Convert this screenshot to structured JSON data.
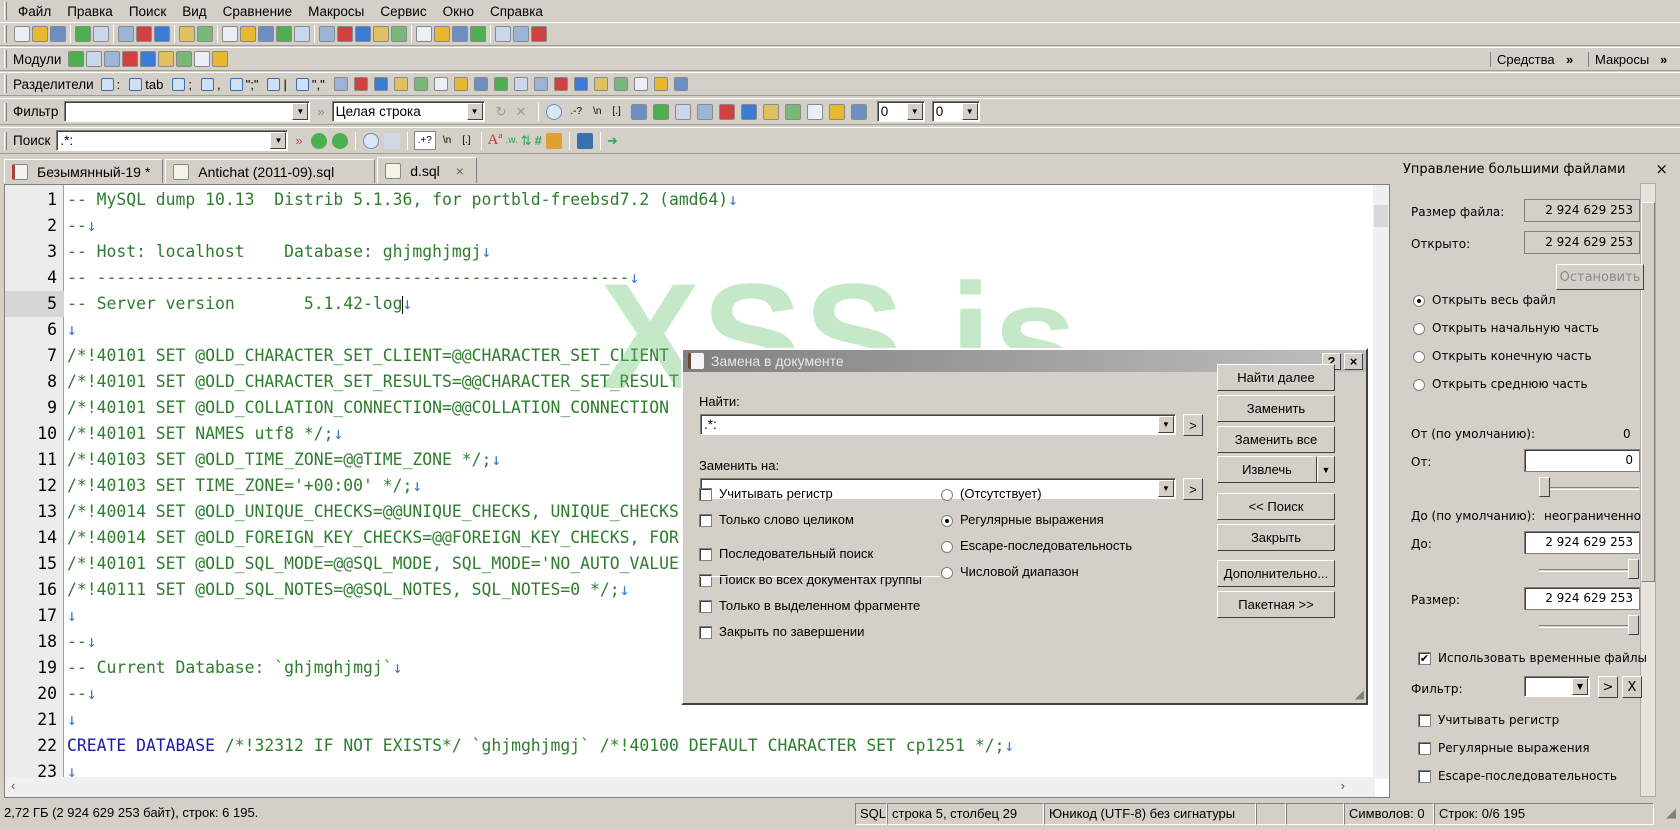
{
  "menu": [
    "Файл",
    "Правка",
    "Поиск",
    "Вид",
    "Сравнение",
    "Макросы",
    "Сервис",
    "Окно",
    "Справка"
  ],
  "toolbar_main": [
    "new-file-icon",
    "open-folder-icon",
    "save-icon",
    "print-icon",
    "print-preview-icon",
    "cut-icon",
    "copy-icon",
    "paste-icon",
    "undo-icon",
    "redo-icon",
    "find-icon",
    "find-next-icon",
    "find-prev-icon",
    "find-in-files-icon",
    "filter-icon",
    "columns-icon",
    "wrap-icon",
    "refresh-icon",
    "compare-icon",
    "tree-icon",
    "globe-icon",
    "macro-icon",
    "macro-edit-icon",
    "chart-icon",
    "stop-record-icon",
    "play-icon",
    "pin-icon"
  ],
  "toolbar_right": {
    "tools": "Средства",
    "macros": "Макросы"
  },
  "modules": {
    "label": "Модули",
    "icons": [
      "folder-icon",
      "table-icon",
      "list-icon",
      "window-icon",
      "output-icon",
      "bookmark-icon",
      "clipboard-icon",
      "large-file-icon",
      "charmap-icon"
    ]
  },
  "separators": {
    "label": "Разделители",
    "items": [
      ":",
      "tab",
      ";",
      ",",
      "\";\"",
      "|",
      "\",\""
    ],
    "icons": [
      "insert-icon",
      "tools-icon",
      "column-icon",
      "csv-icon",
      "sort-az-icon",
      "sort-za-icon",
      "sort-09-icon",
      "sort-90-icon",
      "sort-asc-icon",
      "sort-desc-icon",
      "unique-icon",
      "spell-icon",
      "abc-icon",
      "split-icon",
      "merge-icon",
      "numbering-icon",
      "abc123-icon",
      "ruler-icon"
    ]
  },
  "filter": {
    "label": "Фильтр",
    "value": "",
    "mode": "Целая строка",
    "opts": [
      ".-?",
      "\\n",
      "[.]"
    ],
    "num1": "0",
    "num2": "0"
  },
  "search": {
    "label": "Поиск",
    "value": ".*:",
    "opts": [
      ".+?",
      "\\n",
      "[.]"
    ]
  },
  "tabs": [
    {
      "label": "Безымянный-19 *"
    },
    {
      "label": "Antichat (2011-09).sql"
    },
    {
      "label": "d.sql",
      "close": "×"
    }
  ],
  "editor": {
    "lines": [
      {
        "n": "1",
        "t": "-- MySQL dump 10.13  Distrib 5.1.36, for portbld-freebsd7.2 (amd64)"
      },
      {
        "n": "2",
        "t": "--"
      },
      {
        "n": "3",
        "t": "-- Host: localhost    Database: ghjmghjmgj"
      },
      {
        "n": "4",
        "t": "-- ------------------------------------------------------"
      },
      {
        "n": "5",
        "t": "-- Server version\t5.1.42-log"
      },
      {
        "n": "6",
        "t": ""
      },
      {
        "n": "7",
        "t": "/*!40101 SET @OLD_CHARACTER_SET_CLIENT=@@CHARACTER_SET_CLIENT"
      },
      {
        "n": "8",
        "t": "/*!40101 SET @OLD_CHARACTER_SET_RESULTS=@@CHARACTER_SET_RESULT"
      },
      {
        "n": "9",
        "t": "/*!40101 SET @OLD_COLLATION_CONNECTION=@@COLLATION_CONNECTION"
      },
      {
        "n": "10",
        "t": "/*!40101 SET NAMES utf8 */;"
      },
      {
        "n": "11",
        "t": "/*!40103 SET @OLD_TIME_ZONE=@@TIME_ZONE */;"
      },
      {
        "n": "12",
        "t": "/*!40103 SET TIME_ZONE='+00:00' */;"
      },
      {
        "n": "13",
        "t": "/*!40014 SET @OLD_UNIQUE_CHECKS=@@UNIQUE_CHECKS, UNIQUE_CHECKS"
      },
      {
        "n": "14",
        "t": "/*!40014 SET @OLD_FOREIGN_KEY_CHECKS=@@FOREIGN_KEY_CHECKS, FOR"
      },
      {
        "n": "15",
        "t": "/*!40101 SET @OLD_SQL_MODE=@@SQL_MODE, SQL_MODE='NO_AUTO_VALUE"
      },
      {
        "n": "16",
        "t": "/*!40111 SET @OLD_SQL_NOTES=@@SQL_NOTES, SQL_NOTES=0 */;"
      },
      {
        "n": "17",
        "t": ""
      },
      {
        "n": "18",
        "t": "--"
      },
      {
        "n": "19",
        "t": "-- Current Database: `ghjmghjmgj`"
      },
      {
        "n": "20",
        "t": "--"
      },
      {
        "n": "21",
        "t": ""
      },
      {
        "n": "22",
        "kw": "CREATE DATABASE",
        "t": " /*!32312 IF NOT EXISTS*/ `ghjmghjmgj` /*!40100 DEFAULT CHARACTER SET cp1251 */;"
      },
      {
        "n": "23",
        "t": ""
      }
    ],
    "eol": "↓",
    "current_line": 5
  },
  "watermark": "XSS.is",
  "dialog": {
    "title": "Замена в документе",
    "help": "?",
    "close": "×",
    "find_label": "Найти:",
    "find_value": ".*:",
    "replace_label": "Заменить на:",
    "replace_value": "",
    "checks": [
      {
        "label": "Учитывать регистр",
        "checked": false
      },
      {
        "label": "Только слово целиком",
        "checked": false
      },
      {
        "label": "Последовательный поиск",
        "checked": false
      },
      {
        "label": "Поиск во всех документах группы",
        "checked": false
      },
      {
        "label": "Только в выделенном фрагменте",
        "checked": false
      },
      {
        "label": "Закрыть по завершении",
        "checked": false
      }
    ],
    "radios": [
      {
        "label": "(Отсутствует)",
        "on": false
      },
      {
        "label": "Регулярные выражения",
        "on": true
      },
      {
        "label": "Escape-последовательность",
        "on": false
      },
      {
        "label": "Числовой диапазон",
        "on": false
      }
    ],
    "buttons": {
      "find_next": "Найти далее",
      "replace": "Заменить",
      "replace_all": "Заменить все",
      "extract": "Извлечь",
      "search_less": "<< Поиск",
      "close": "Закрыть",
      "more": "Дополнительно...",
      "batch": "Пакетная >>"
    }
  },
  "panel": {
    "title": "Управление большими файлами",
    "close": "×",
    "file_size_label": "Размер файла:",
    "file_size": "2 924 629 253",
    "opened_label": "Открыто:",
    "opened": "2 924 629 253",
    "stop": "Остановить",
    "radios": [
      {
        "label": "Открыть весь файл",
        "on": true
      },
      {
        "label": "Открыть начальную часть",
        "on": false
      },
      {
        "label": "Открыть конечную часть",
        "on": false
      },
      {
        "label": "Открыть среднюю часть",
        "on": false
      }
    ],
    "from_default_label": "От (по умолчанию):",
    "from_default": "0",
    "from_label": "От:",
    "from": "0",
    "from_slider": 0,
    "to_default_label": "До (по умолчанию):",
    "to_default": "неограниченно",
    "to_label": "До:",
    "to": "2 924 629 253",
    "to_slider": 1,
    "size_label": "Размер:",
    "size": "2 924 629 253",
    "size_slider": 1,
    "use_temp": "Использовать временные файлы",
    "filter_label": "Фильтр:",
    "checks": [
      "Учитывать регистр",
      "Регулярные выражения",
      "Escape-последовательность"
    ]
  },
  "status": {
    "info": "2,72 ГБ (2 924 629 253 байт), строк: 6 195.",
    "syntax": "SQL",
    "pos": "строка 5, столбец 29",
    "encoding": "Юникод (UTF-8) без сигнатуры",
    "chars": "Символов: 0",
    "lines": "Строк: 0/6 195"
  }
}
